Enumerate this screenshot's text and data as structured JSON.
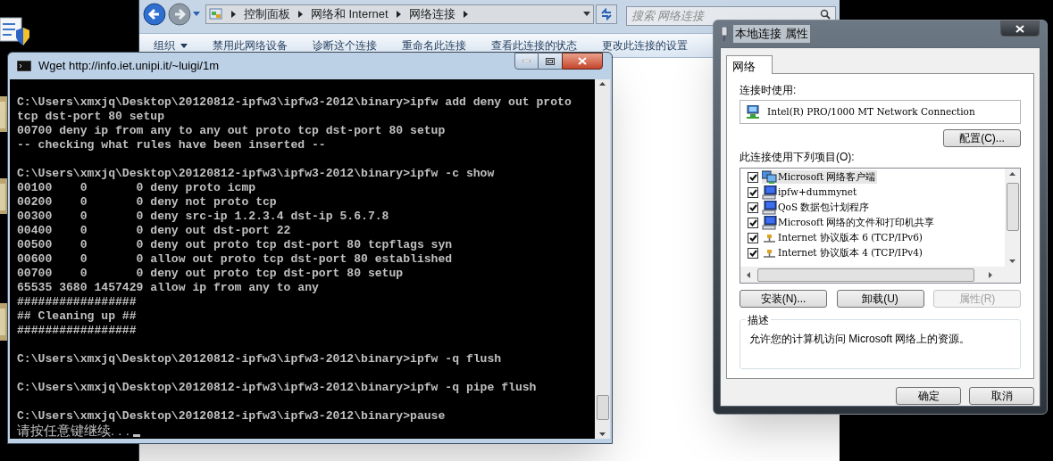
{
  "explorer": {
    "breadcrumbs": [
      "控制面板",
      "网络和 Internet",
      "网络连接"
    ],
    "search": {
      "placeholder": "搜索 网络连接"
    },
    "toolbar": [
      {
        "label": "组织",
        "menu": true
      },
      {
        "label": "禁用此网络设备",
        "menu": false
      },
      {
        "label": "诊断这个连接",
        "menu": false
      },
      {
        "label": "重命名此连接",
        "menu": false
      },
      {
        "label": "查看此连接的状态",
        "menu": false
      },
      {
        "label": "更改此连接的设置",
        "menu": false
      }
    ]
  },
  "console": {
    "title": "Wget http://info.iet.unipi.it/~luigi/1m",
    "lines": [
      {
        "kind": "blank"
      },
      {
        "kind": "text",
        "text": "C:\\Users\\xmxjq\\Desktop\\20120812-ipfw3\\ipfw3-2012\\binary>ipfw add deny out proto"
      },
      {
        "kind": "text",
        "text": "tcp dst-port 80 setup"
      },
      {
        "kind": "text",
        "text": "00700 deny ip from any to any out proto tcp dst-port 80 setup"
      },
      {
        "kind": "text",
        "text": "-- checking what rules have been inserted --"
      },
      {
        "kind": "blank"
      },
      {
        "kind": "text",
        "text": "C:\\Users\\xmxjq\\Desktop\\20120812-ipfw3\\ipfw3-2012\\binary>ipfw -c show"
      },
      {
        "kind": "text",
        "text": "00100    0       0 deny proto icmp"
      },
      {
        "kind": "text",
        "text": "00200    0       0 deny not proto tcp"
      },
      {
        "kind": "text",
        "text": "00300    0       0 deny src-ip 1.2.3.4 dst-ip 5.6.7.8"
      },
      {
        "kind": "text",
        "text": "00400    0       0 deny out dst-port 22"
      },
      {
        "kind": "text",
        "text": "00500    0       0 deny out proto tcp dst-port 80 tcpflags syn"
      },
      {
        "kind": "text",
        "text": "00600    0       0 allow out proto tcp dst-port 80 established"
      },
      {
        "kind": "text",
        "text": "00700    0       0 deny out proto tcp dst-port 80 setup"
      },
      {
        "kind": "text",
        "text": "65535 3680 1457429 allow ip from any to any"
      },
      {
        "kind": "text",
        "text": "#################"
      },
      {
        "kind": "text",
        "text": "## Cleaning up ##"
      },
      {
        "kind": "text",
        "text": "#################"
      },
      {
        "kind": "blank"
      },
      {
        "kind": "text",
        "text": "C:\\Users\\xmxjq\\Desktop\\20120812-ipfw3\\ipfw3-2012\\binary>ipfw -q flush"
      },
      {
        "kind": "blank"
      },
      {
        "kind": "text",
        "text": "C:\\Users\\xmxjq\\Desktop\\20120812-ipfw3\\ipfw3-2012\\binary>ipfw -q pipe flush"
      },
      {
        "kind": "blank"
      },
      {
        "kind": "text",
        "text": "C:\\Users\\xmxjq\\Desktop\\20120812-ipfw3\\ipfw3-2012\\binary>pause"
      },
      {
        "kind": "prompt",
        "text": "请按任意键继续. . ."
      }
    ]
  },
  "dialog": {
    "title": "本地连接 属性",
    "tabs": [
      {
        "label": "网络",
        "selected": true
      }
    ],
    "connect_using_label": "连接时使用:",
    "adapter": "Intel(R) PRO/1000 MT Network Connection",
    "configure_button": "配置(C)...",
    "items_label": "此连接使用下列项目(O):",
    "items": [
      {
        "label": "Microsoft 网络客户端",
        "kind": "client",
        "checked": true,
        "selected": true
      },
      {
        "label": "ipfw+dummynet",
        "kind": "service",
        "checked": true,
        "selected": false
      },
      {
        "label": "QoS 数据包计划程序",
        "kind": "service",
        "checked": true,
        "selected": false
      },
      {
        "label": "Microsoft 网络的文件和打印机共享",
        "kind": "service",
        "checked": true,
        "selected": false
      },
      {
        "label": "Internet 协议版本 6 (TCP/IPv6)",
        "kind": "protocol",
        "checked": true,
        "selected": false
      },
      {
        "label": "Internet 协议版本 4 (TCP/IPv4)",
        "kind": "protocol",
        "checked": true,
        "selected": false
      }
    ],
    "buttons": [
      {
        "label": "安装(N)...",
        "disabled": false
      },
      {
        "label": "卸载(U)",
        "disabled": false
      },
      {
        "label": "属性(R)",
        "disabled": true
      }
    ],
    "description_label": "描述",
    "description": "允许您的计算机访问 Microsoft 网络上的资源。",
    "footer_buttons": [
      "确定",
      "取消"
    ]
  }
}
